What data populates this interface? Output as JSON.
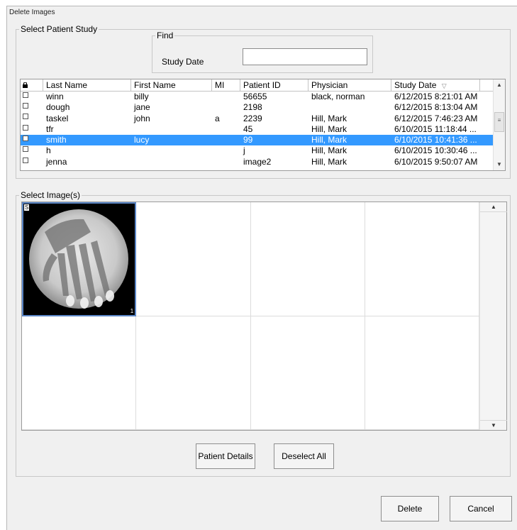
{
  "window": {
    "title": "Delete Images"
  },
  "patient_study": {
    "group_label": "Select Patient Study",
    "find": {
      "group_label": "Find",
      "study_date_label": "Study Date",
      "study_date_value": ""
    },
    "table": {
      "columns": [
        "",
        "Last Name",
        "First Name",
        "MI",
        "Patient ID",
        "Physician",
        "Study Date"
      ],
      "sort_indicator": "▽",
      "rows": [
        {
          "last": "winn",
          "first": "billy",
          "mi": "",
          "pid": "56655",
          "physician": "black, norman",
          "date": "6/12/2015 8:21:01 AM",
          "selected": false
        },
        {
          "last": "dough",
          "first": "jane",
          "mi": "",
          "pid": "2198",
          "physician": "",
          "date": "6/12/2015 8:13:04 AM",
          "selected": false
        },
        {
          "last": "taskel",
          "first": "john",
          "mi": "a",
          "pid": "2239",
          "physician": "Hill, Mark",
          "date": "6/12/2015 7:46:23 AM",
          "selected": false
        },
        {
          "last": "tfr",
          "first": "",
          "mi": "",
          "pid": "45",
          "physician": "Hill, Mark",
          "date": "6/10/2015 11:18:44 ...",
          "selected": false
        },
        {
          "last": "smith",
          "first": "lucy",
          "mi": "",
          "pid": "99",
          "physician": "Hill, Mark",
          "date": "6/10/2015 10:41:36 ...",
          "selected": true
        },
        {
          "last": "h",
          "first": "",
          "mi": "",
          "pid": "j",
          "physician": "Hill, Mark",
          "date": "6/10/2015 10:30:46 ...",
          "selected": false
        },
        {
          "last": "jenna",
          "first": "",
          "mi": "",
          "pid": "image2",
          "physician": "Hill, Mark",
          "date": "6/10/2015 9:50:07 AM",
          "selected": false
        }
      ]
    }
  },
  "images": {
    "group_label": "Select Image(s)",
    "thumb_top_badge": "S",
    "thumb_bottom_badge": "1"
  },
  "buttons": {
    "patient_details": "Patient Details",
    "deselect_all": "Deselect All",
    "delete": "Delete",
    "cancel": "Cancel"
  },
  "colors": {
    "selection": "#3399ff",
    "dialog_bg": "#f0f0f0",
    "thumb_border": "#5b86c6"
  },
  "icons": [
    "lock-icon",
    "sort-desc-icon",
    "scroll-up-icon",
    "scroll-down-icon",
    "scroll-thumb-icon"
  ]
}
